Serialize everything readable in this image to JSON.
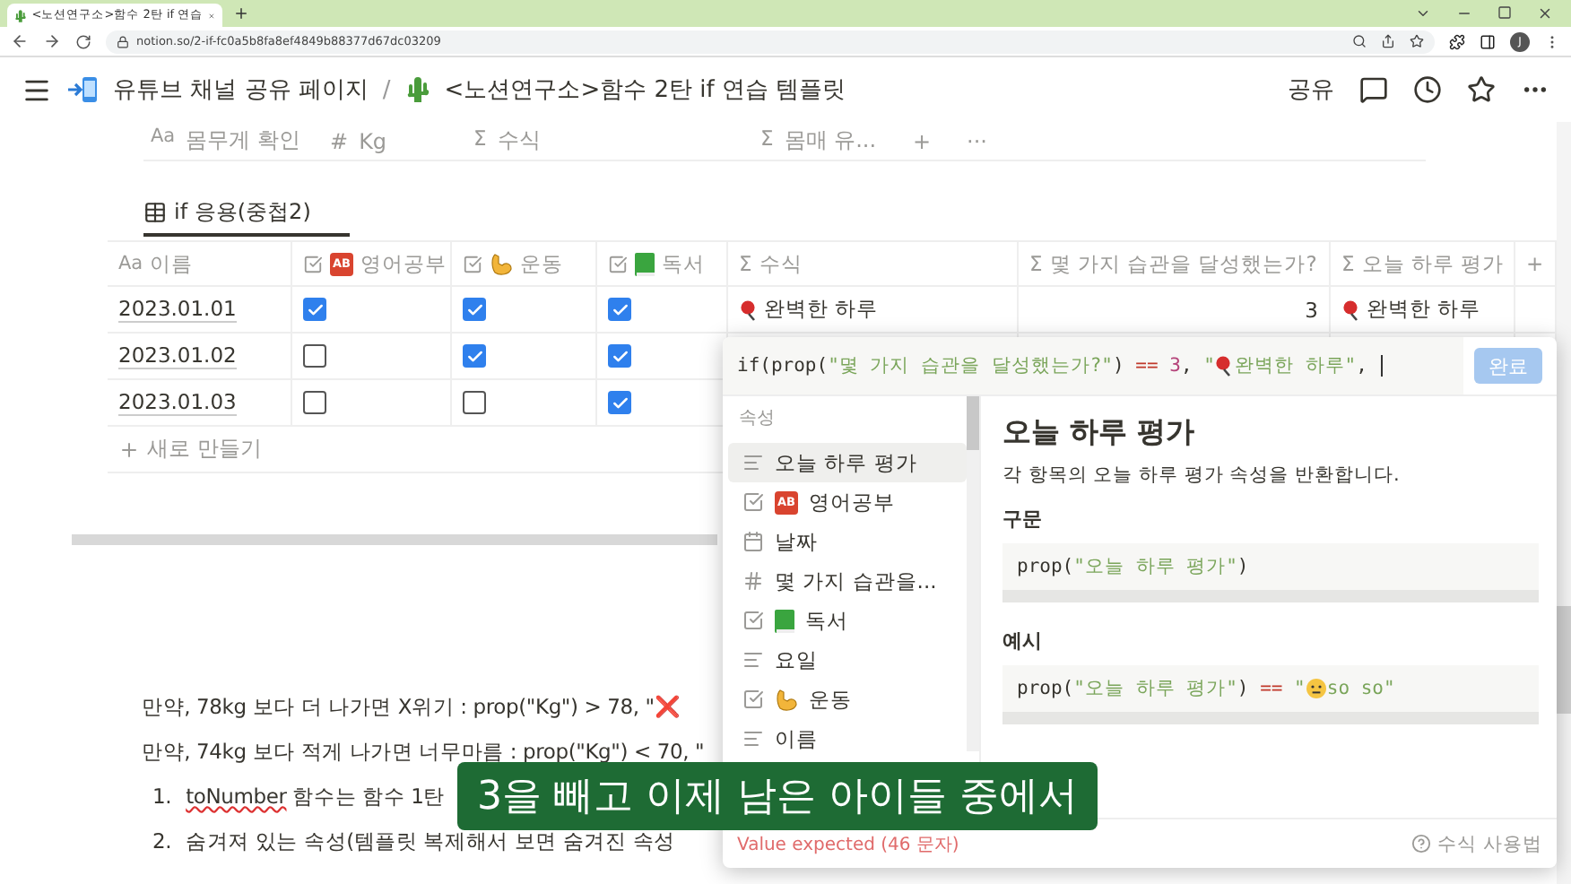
{
  "browser": {
    "tab_title": "<노션연구소>함수 2탄 if 연습",
    "url": "notion.so/2-if-fc0a5b8fa8ef4849b88377d67dc03209",
    "profile_initial": "J"
  },
  "topbar": {
    "breadcrumbs": [
      {
        "kind": "workspace",
        "label": "유튜브 채널 공유 페이지"
      },
      {
        "kind": "page",
        "label": "<노션연구소>함수 2탄 if 연습 템플릿"
      }
    ],
    "separator": "/",
    "share": "공유"
  },
  "upper_table": {
    "columns": [
      {
        "kind": "title",
        "icon_text": "Aa",
        "label": "몸무게 확인"
      },
      {
        "kind": "number",
        "icon_text": "#",
        "label": "Kg"
      },
      {
        "kind": "formula",
        "icon_text": "Σ",
        "label": "수식"
      },
      {
        "kind": "formula",
        "icon_text": "Σ",
        "label": "몸매 유..."
      }
    ],
    "add": "+",
    "more": "···"
  },
  "view_tab": {
    "label": "if 응용(중첩2)",
    "selected": true
  },
  "table": {
    "columns": [
      {
        "kind": "title",
        "icon_text": "Aa",
        "label": "이름"
      },
      {
        "kind": "badge-checkbox",
        "badge": "AB",
        "label": "영어공부"
      },
      {
        "kind": "arm-checkbox",
        "label": "운동"
      },
      {
        "kind": "book-checkbox",
        "label": "독서"
      },
      {
        "kind": "formula",
        "icon_text": "Σ",
        "label": "수식"
      },
      {
        "kind": "formula",
        "icon_text": "Σ",
        "label": "몇 가지 습관을 달성했는가?"
      },
      {
        "kind": "formula",
        "icon_text": "Σ",
        "label": "오늘 하루 평가"
      }
    ],
    "add_column": "+",
    "rows": [
      {
        "name": "2023.01.01",
        "english": true,
        "exercise": true,
        "reading": true,
        "formula": "완벽한 하루",
        "count": "3",
        "rating": "완벽한 하루"
      },
      {
        "name": "2023.01.02",
        "english": false,
        "exercise": true,
        "reading": true
      },
      {
        "name": "2023.01.03",
        "english": false,
        "exercise": false,
        "reading": true
      }
    ],
    "new_row": "새로 만들기"
  },
  "body": {
    "paragraphs": [
      "만약, 78kg 보다 더 나가면 X위기 : prop(\"Kg\") > 78, \"❌",
      "만약, 74kg 보다 적게 나가면 너무마름 : prop(\"Kg\") < 70, \""
    ],
    "list": [
      {
        "marker": "1.",
        "text": "toNumber 함수는 함수 1탄",
        "underline_word": true
      },
      {
        "marker": "2.",
        "text": "숨겨져 있는 속성(템플릿 복제해서 보면 숨겨진 속성",
        "underline_word": false
      }
    ]
  },
  "formula_editor": {
    "tokens": [
      {
        "kind": "plain",
        "text": "if(prop("
      },
      {
        "kind": "string",
        "text": "\"몇 가지 습관을 달성했는가?\""
      },
      {
        "kind": "plain",
        "text": ") "
      },
      {
        "kind": "operator",
        "text": "=="
      },
      {
        "kind": "number",
        "text": " 3"
      },
      {
        "kind": "plain",
        "text": ", "
      },
      {
        "kind": "string",
        "text": "\""
      },
      {
        "kind": "pin"
      },
      {
        "kind": "string",
        "text": "완벽한 하루\""
      },
      {
        "kind": "plain",
        "text": ", "
      }
    ],
    "done": "완료",
    "done_disabled": true,
    "section_label": "속성",
    "properties": [
      {
        "kind": "text",
        "label": "오늘 하루 평가",
        "selected": true
      },
      {
        "kind": "badge-checkbox",
        "badge": "AB",
        "label": "영어공부",
        "selected": false
      },
      {
        "kind": "date",
        "label": "날짜",
        "selected": false
      },
      {
        "kind": "number",
        "label": "몇 가지 습관을...",
        "selected": false
      },
      {
        "kind": "book-checkbox",
        "label": "독서",
        "selected": false
      },
      {
        "kind": "text",
        "label": "요일",
        "selected": false
      },
      {
        "kind": "arm-checkbox",
        "label": "운동",
        "selected": false
      },
      {
        "kind": "text",
        "label": "이름",
        "selected": false
      }
    ],
    "detail": {
      "title": "오늘 하루 평가",
      "description": "각 항목의 오늘 하루 평가 속성을 반환합니다.",
      "syntax_label": "구문",
      "syntax": [
        {
          "kind": "plain",
          "text": "prop("
        },
        {
          "kind": "string",
          "text": "\"오늘 하루 평가\""
        },
        {
          "kind": "plain",
          "text": ")"
        }
      ],
      "example_label": "예시",
      "example": [
        {
          "kind": "plain",
          "text": "prop("
        },
        {
          "kind": "string",
          "text": "\"오늘 하루 평가\""
        },
        {
          "kind": "plain",
          "text": ") "
        },
        {
          "kind": "operator",
          "text": "=="
        },
        {
          "kind": "string",
          "text": " \""
        },
        {
          "kind": "smiley"
        },
        {
          "kind": "string",
          "text": "so so\""
        }
      ]
    },
    "error": "Value expected (46 문자)",
    "help": "수식 사용법"
  },
  "subtitle": "3을 빼고 이제 남은 아이들 중에서"
}
